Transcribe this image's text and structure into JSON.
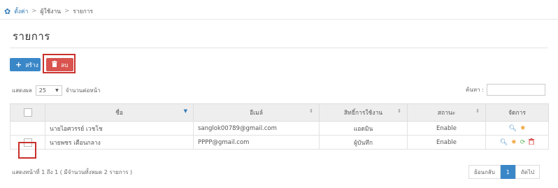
{
  "breadcrumb": {
    "items": [
      "ตั้งค่า",
      "ผู้ใช้งาน",
      "รายการ"
    ],
    "separator": ">"
  },
  "page": {
    "title": "รายการ"
  },
  "toolbar": {
    "create_label": "สร้าง",
    "delete_label": "ลบ"
  },
  "table_controls": {
    "show_label": "แสดงผล",
    "page_length": "25",
    "per_page_label": "จำนวนต่อหน้า",
    "search_label": "ค้นหา :",
    "search_value": ""
  },
  "table": {
    "columns": [
      "ชื่อ",
      "อีเมล์",
      "สิทธิ์การใช้งาน",
      "สถานะ",
      "จัดการ"
    ],
    "rows": [
      {
        "name": "นายไอศวรรย์ เวชโช",
        "email": "sanglok00789@gmail.com",
        "role": "แอดมิน",
        "status": "Enable",
        "actions": [
          "view-icon",
          "edit-icon"
        ]
      },
      {
        "name": "นายพชร เตือนกลาง",
        "email": "PPPP@gmail.com",
        "role": "ผู้บันทึก",
        "status": "Enable",
        "actions": [
          "view-icon",
          "edit-icon",
          "reset-icon",
          "delete-icon"
        ]
      }
    ]
  },
  "footer": {
    "info": "แสดงหน้าที่ 1 ถึง 1 ( มีจำนวนทั้งหมด 2 รายการ )",
    "prev": "ย้อนกลับ",
    "current_page": "1",
    "next": "ถัดไป"
  },
  "colors": {
    "primary": "#3a87c8",
    "danger": "#d9534f",
    "highlight": "#c9302c"
  }
}
